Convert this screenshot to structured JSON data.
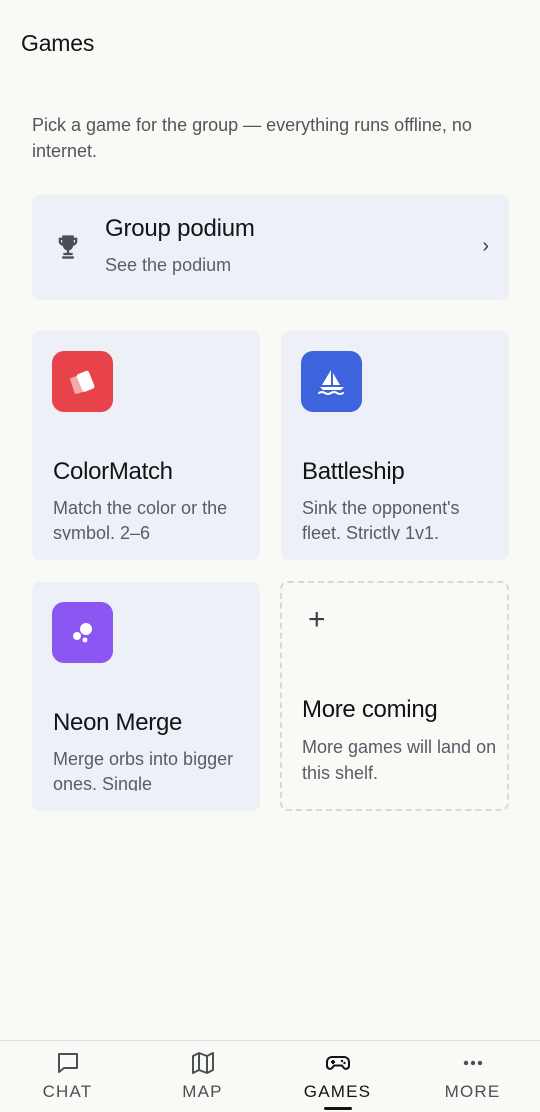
{
  "header": {
    "title": "Games"
  },
  "intro": "Pick a game for the group — everything runs offline, no internet.",
  "podium": {
    "title": "Group podium",
    "subtitle": "See the podium",
    "chevron": "›",
    "icon": "trophy-icon"
  },
  "games": [
    {
      "title": "ColorMatch",
      "description": "Match the color or the symbol. 2–6",
      "icon": "cards-icon",
      "color": "#e8434b"
    },
    {
      "title": "Battleship",
      "description": "Sink the opponent's fleet. Strictly 1v1.",
      "icon": "sailboat-icon",
      "color": "#3d63dd"
    },
    {
      "title": "Neon Merge",
      "description": "Merge orbs into bigger ones. Single",
      "icon": "orbs-icon",
      "color": "#8c56f2"
    }
  ],
  "more": {
    "plus": "+",
    "title": "More coming",
    "description": "More games will land on this shelf."
  },
  "nav": {
    "items": [
      {
        "label": "CHAT",
        "icon": "chat-icon",
        "active": false
      },
      {
        "label": "MAP",
        "icon": "map-icon",
        "active": false
      },
      {
        "label": "GAMES",
        "icon": "gamepad-icon",
        "active": true
      },
      {
        "label": "MORE",
        "icon": "more-dots-icon",
        "active": false
      }
    ]
  },
  "colors": {
    "background": "#f9f9f6",
    "card": "#edf1f7",
    "text": "#111316"
  }
}
